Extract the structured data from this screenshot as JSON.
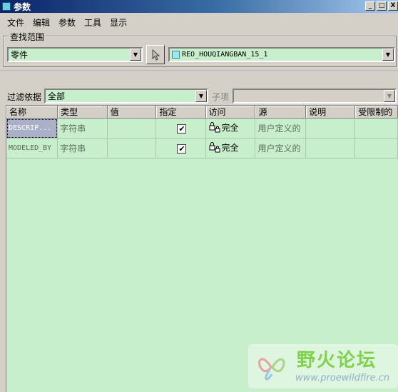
{
  "window": {
    "title": "参数",
    "buttons": [
      "_",
      "□",
      "X"
    ]
  },
  "menu": [
    "文件",
    "编辑",
    "参数",
    "工具",
    "显示"
  ],
  "search_scope": {
    "legend": "查找范围",
    "type_value": "零件",
    "model_value": "REO_HOUQIANGBAN_15_1"
  },
  "filter": {
    "label": "过滤依据",
    "value": "全部",
    "subitem_label": "子项",
    "subitem_value": ""
  },
  "table": {
    "columns": [
      "名称",
      "类型",
      "值",
      "指定",
      "访问",
      "源",
      "说明",
      "受限制的"
    ],
    "rows": [
      {
        "name": "DESCRIP...",
        "type": "字符串",
        "value": "",
        "designated": "✔",
        "access": "完全",
        "source": "用户定义的",
        "description": "",
        "restricted": ""
      },
      {
        "name": "MODELED_BY",
        "type": "字符串",
        "value": "",
        "designated": "✔",
        "access": "完全",
        "source": "用户定义的",
        "description": "",
        "restricted": ""
      }
    ]
  },
  "watermark": {
    "title": "野火论坛",
    "url": "www.proewildfire.cn"
  },
  "colors": {
    "table_bg": "#c8efcc",
    "titlebar_start": "#0a246a",
    "watermark_green": "#7fd24a"
  }
}
